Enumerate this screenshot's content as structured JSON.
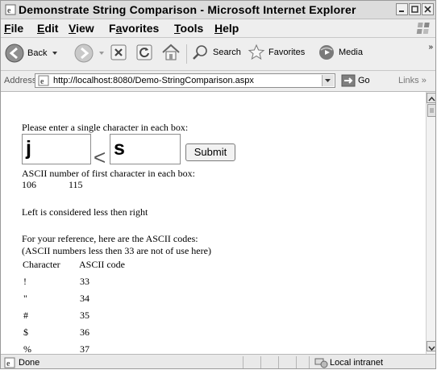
{
  "window": {
    "title": "Demonstrate String Comparison - Microsoft Internet Explorer"
  },
  "menu": {
    "items": [
      {
        "mnemonic": "F",
        "rest": "ile"
      },
      {
        "mnemonic": "E",
        "rest": "dit"
      },
      {
        "mnemonic": "V",
        "rest": "iew"
      },
      {
        "pre": "F",
        "mnemonic": "a",
        "rest": "vorites"
      },
      {
        "mnemonic": "T",
        "rest": "ools"
      },
      {
        "mnemonic": "H",
        "rest": "elp"
      }
    ]
  },
  "toolbar": {
    "back_label": "Back",
    "search_label": "Search",
    "favorites_label": "Favorites",
    "media_label": "Media"
  },
  "address": {
    "label": "Address",
    "url": "http://localhost:8080/Demo-StringComparison.aspx",
    "go_label": "Go",
    "links_label": "Links"
  },
  "page": {
    "prompt": "Please enter a single character in each box:",
    "left_value": "j",
    "operator": "<",
    "right_value": "s",
    "submit_label": "Submit",
    "ascii_heading": "ASCII number of first character in each box:",
    "ascii_left": "106",
    "ascii_right": "115",
    "result": "Left is considered less then right",
    "reference_line1": "For your reference, here are the ASCII codes:",
    "reference_line2": "(ASCII numbers less then 33 are not of use here)",
    "table_headers": {
      "character": "Character",
      "code": "ASCII code"
    },
    "table_rows": [
      {
        "char": "!",
        "code": "33"
      },
      {
        "char": "\"",
        "code": "34"
      },
      {
        "char": "#",
        "code": "35"
      },
      {
        "char": "$",
        "code": "36"
      },
      {
        "char": "%",
        "code": "37"
      }
    ]
  },
  "status": {
    "text": "Done",
    "zone": "Local intranet"
  }
}
